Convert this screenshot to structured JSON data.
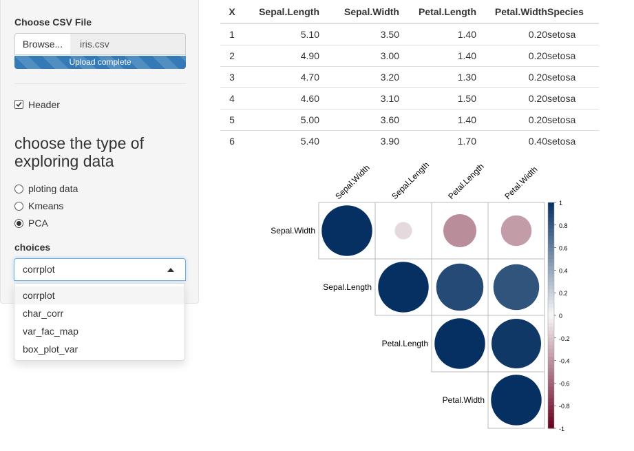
{
  "sidebar": {
    "file_label": "Choose CSV File",
    "browse_label": "Browse...",
    "file_name": "iris.csv",
    "upload_status": "Upload complete",
    "upload_progress": 1.0,
    "header_label": "Header",
    "header_checked": true,
    "heading": "choose the type of exploring data",
    "radio_options": [
      {
        "label": "ploting data",
        "selected": false
      },
      {
        "label": "Kmeans",
        "selected": false
      },
      {
        "label": "PCA",
        "selected": true
      }
    ],
    "choices_label": "choices",
    "select_value": "corrplot",
    "dropdown_options": [
      "corrplot",
      "char_corr",
      "var_fac_map",
      "box_plot_var"
    ],
    "dropdown_active": "corrplot"
  },
  "table": {
    "headers": [
      "X",
      "Sepal.Length",
      "Sepal.Width",
      "Petal.Length",
      "Petal.Width",
      "Species"
    ],
    "rows": [
      [
        "1",
        "5.10",
        "3.50",
        "1.40",
        "0.20",
        "setosa"
      ],
      [
        "2",
        "4.90",
        "3.00",
        "1.40",
        "0.20",
        "setosa"
      ],
      [
        "3",
        "4.70",
        "3.20",
        "1.30",
        "0.20",
        "setosa"
      ],
      [
        "4",
        "4.60",
        "3.10",
        "1.50",
        "0.20",
        "setosa"
      ],
      [
        "5",
        "5.00",
        "3.60",
        "1.40",
        "0.20",
        "setosa"
      ],
      [
        "6",
        "5.40",
        "3.90",
        "1.70",
        "0.40",
        "setosa"
      ]
    ]
  },
  "chart_data": {
    "type": "heatmap",
    "variables": [
      "Sepal.Width",
      "Sepal.Length",
      "Petal.Length",
      "Petal.Width"
    ],
    "cells": [
      {
        "row": "Sepal.Width",
        "col": "Sepal.Width",
        "value": 1.0
      },
      {
        "row": "Sepal.Width",
        "col": "Sepal.Length",
        "value": -0.12
      },
      {
        "row": "Sepal.Width",
        "col": "Petal.Length",
        "value": -0.43
      },
      {
        "row": "Sepal.Width",
        "col": "Petal.Width",
        "value": -0.37
      },
      {
        "row": "Sepal.Length",
        "col": "Sepal.Length",
        "value": 1.0
      },
      {
        "row": "Sepal.Length",
        "col": "Petal.Length",
        "value": 0.87
      },
      {
        "row": "Sepal.Length",
        "col": "Petal.Width",
        "value": 0.82
      },
      {
        "row": "Petal.Length",
        "col": "Petal.Length",
        "value": 1.0
      },
      {
        "row": "Petal.Length",
        "col": "Petal.Width",
        "value": 0.96
      },
      {
        "row": "Petal.Width",
        "col": "Petal.Width",
        "value": 1.0
      }
    ],
    "colorbar_ticks": [
      "1",
      "0.8",
      "0.6",
      "0.4",
      "0.2",
      "0",
      "-0.2",
      "-0.4",
      "-0.6",
      "-0.8",
      "-1"
    ],
    "color_range": [
      -1,
      1
    ],
    "colors": {
      "negative": "#67001f",
      "zero": "#f7f7f7",
      "positive": "#053061"
    },
    "shape": "circle",
    "layout": "upper triangle"
  }
}
